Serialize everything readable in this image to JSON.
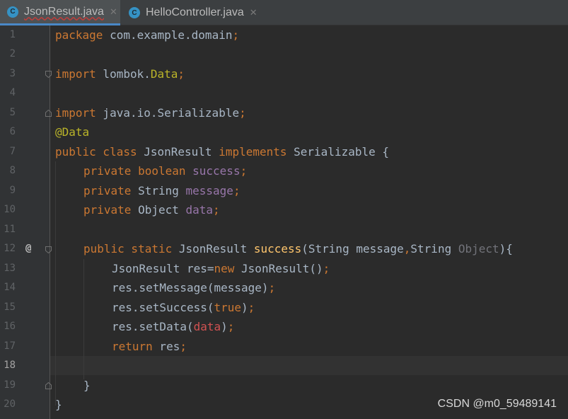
{
  "tabs": [
    {
      "label": "JsonResult.java",
      "icon": "C",
      "active": true
    },
    {
      "label": "HelloController.java",
      "icon": "C",
      "active": false
    }
  ],
  "line_numbers": [
    "1",
    "2",
    "3",
    "4",
    "5",
    "6",
    "7",
    "8",
    "9",
    "10",
    "11",
    "12",
    "13",
    "14",
    "15",
    "16",
    "17",
    "18",
    "19",
    "20"
  ],
  "current_line": "18",
  "gutter": {
    "override_marker": "@"
  },
  "code": {
    "l1": {
      "a": "package",
      "b": " com.example.domain",
      "c": ";"
    },
    "l3": {
      "a": "import",
      "b": " lombok.",
      "c": "Data",
      "d": ";"
    },
    "l5": {
      "a": "import",
      "b": " java.io.Serializable",
      "c": ";"
    },
    "l6": {
      "a": "@Data"
    },
    "l7": {
      "a": "public class",
      "b": " JsonResult ",
      "c": "implements",
      "d": " Serializable {"
    },
    "l8": {
      "a": "private boolean",
      "b": " ",
      "c": "success",
      "d": ";"
    },
    "l9": {
      "a": "private",
      "b": " String ",
      "c": "message",
      "d": ";"
    },
    "l10": {
      "a": "private",
      "b": " Object ",
      "c": "data",
      "d": ";"
    },
    "l12": {
      "a": "public static",
      "b": " JsonResult ",
      "c": "success",
      "d": "(String message",
      "e": ",",
      "f": "String ",
      "g": "Object",
      "h": "){"
    },
    "l13": {
      "a": "JsonResult res=",
      "b": "new",
      "c": " JsonResult()",
      "d": ";"
    },
    "l14": {
      "a": "res.setMessage(message)",
      "b": ";"
    },
    "l15": {
      "a": "res.setSuccess(",
      "b": "true",
      "c": ")",
      "d": ";"
    },
    "l16": {
      "a": "res.setData(",
      "b": "data",
      "c": ")",
      "d": ";"
    },
    "l17": {
      "a": "return",
      "b": " res",
      "c": ";"
    },
    "l19": {
      "a": "}"
    },
    "l20": {
      "a": "}"
    }
  },
  "watermark": "CSDN @m0_59489141",
  "colors": {
    "keyword": "#cc7832",
    "annotation": "#bbb529",
    "field": "#9876aa",
    "method": "#ffc66d",
    "text": "#a9b7c6",
    "tab_underline": "#4a88c7"
  }
}
